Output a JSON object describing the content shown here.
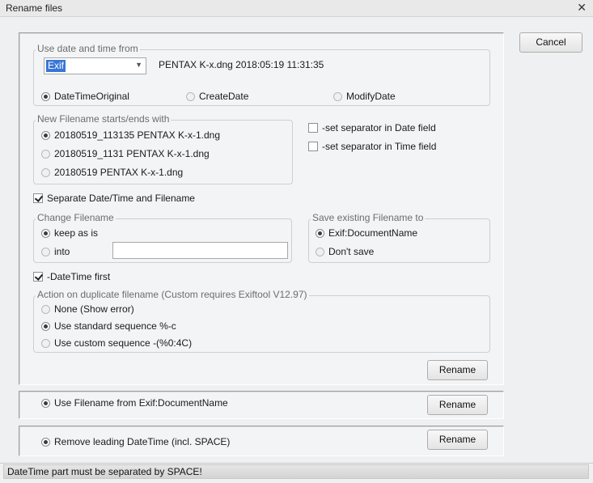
{
  "window": {
    "title": "Rename files",
    "close_glyph": "✕"
  },
  "cancel_button": "Cancel",
  "date_group": {
    "legend": "Use date and time from",
    "source_selected": "Exif",
    "file_info": "PENTAX K-x.dng 2018:05:19 11:31:35",
    "options": [
      {
        "label": "DateTimeOriginal",
        "checked": true
      },
      {
        "label": "CreateDate",
        "checked": false
      },
      {
        "label": "ModifyDate",
        "checked": false
      }
    ]
  },
  "new_name_group": {
    "legend": "New Filename starts/ends with",
    "options": [
      {
        "label": "20180519_113135 PENTAX K-x-1.dng",
        "checked": true
      },
      {
        "label": "20180519_1131 PENTAX K-x-1.dng",
        "checked": false
      },
      {
        "label": "20180519 PENTAX K-x-1.dng",
        "checked": false
      }
    ]
  },
  "separator_checks": {
    "date": {
      "label": "-set separator in Date field",
      "checked": false
    },
    "time": {
      "label": "-set separator in Time field",
      "checked": false
    }
  },
  "separate_check": {
    "label": "Separate Date/Time and Filename",
    "checked": true
  },
  "change_group": {
    "legend": "Change Filename",
    "keep": {
      "label": "keep as is",
      "checked": true
    },
    "into": {
      "label": "into",
      "checked": false,
      "value": ""
    }
  },
  "save_group": {
    "legend": "Save existing Filename to",
    "options": [
      {
        "label": "Exif:DocumentName",
        "checked": true
      },
      {
        "label": "Don't save",
        "checked": false
      }
    ]
  },
  "datetime_first": {
    "label": "-DateTime first",
    "checked": true
  },
  "duplicate_group": {
    "legend": "Action on duplicate filename (Custom requires Exiftool V12.97)",
    "options": [
      {
        "label": "None (Show error)",
        "checked": false
      },
      {
        "label": "Use standard sequence %-c",
        "checked": true
      },
      {
        "label": "Use custom sequence -(%0:4C)",
        "checked": false
      }
    ]
  },
  "rename_label": "Rename",
  "use_filename_option": {
    "label": "Use Filename from Exif:DocumentName",
    "checked": true
  },
  "remove_leading_option": {
    "label": "Remove leading DateTime (incl. SPACE)",
    "checked": true
  },
  "status": "DateTime part must be separated by SPACE!"
}
